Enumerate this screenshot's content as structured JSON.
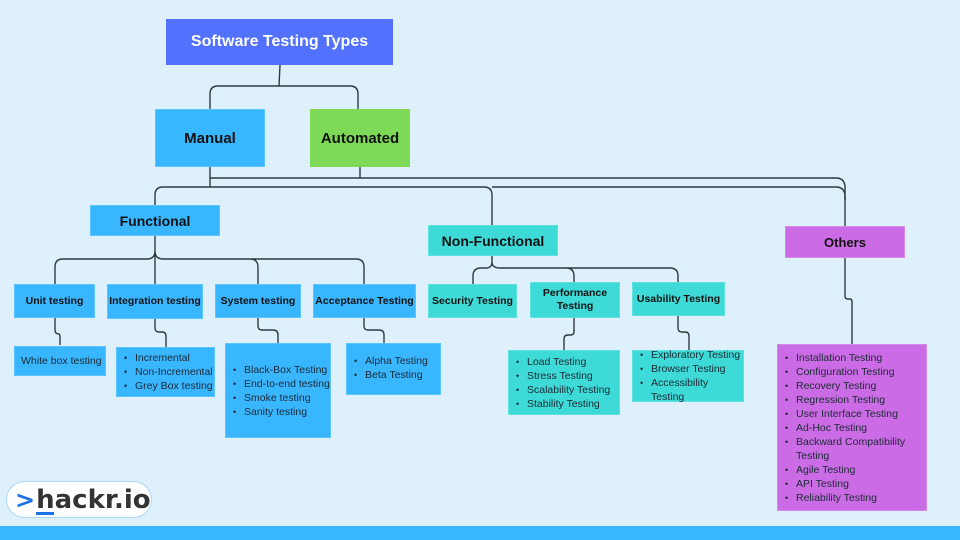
{
  "title": "Software Testing Types",
  "categories": {
    "manual": "Manual",
    "automated": "Automated"
  },
  "branches": {
    "functional": {
      "label": "Functional",
      "children": {
        "unit": {
          "label": "Unit testing",
          "items": [
            "White box testing"
          ]
        },
        "integration": {
          "label": "Integration testing",
          "items": [
            "Incremental",
            "Non-Incremental",
            "Grey Box testing"
          ]
        },
        "system": {
          "label": "System testing",
          "items": [
            "Black-Box Testing",
            "End-to-end testing",
            "Smoke testing",
            "Sanity testing"
          ]
        },
        "acceptance": {
          "label": "Acceptance Testing",
          "items": [
            "Alpha Testing",
            "Beta Testing"
          ]
        }
      }
    },
    "non_functional": {
      "label": "Non-Functional",
      "children": {
        "security": {
          "label": "Security Testing"
        },
        "performance": {
          "label": "Performance Testing",
          "items": [
            "Load Testing",
            "Stress Testing",
            "Scalability Testing",
            "Stability Testing"
          ]
        },
        "usability": {
          "label": "Usability Testing",
          "items": [
            "Exploratory Testing",
            "Browser Testing",
            "Accessibility Testing"
          ]
        }
      }
    },
    "others": {
      "label": "Others",
      "items": [
        "Installation Testing",
        "Configuration Testing",
        "Recovery Testing",
        "Regression Testing",
        "User Interface Testing",
        "Ad-Hoc Testing",
        "Backward Compatibility Testing",
        "Agile Testing",
        "API Testing",
        "Reliability Testing"
      ]
    }
  },
  "colors": {
    "background": "#dff0fd",
    "root": "#5271ff",
    "manual_functional": "#38b6ff",
    "automated": "#7ed957",
    "non_functional": "#3ddad7",
    "others": "#cb6ce6",
    "logo_accent": "#1a73e8"
  },
  "logo": {
    "prefix": ">",
    "first_letter": "h",
    "rest": "ackr.io"
  }
}
